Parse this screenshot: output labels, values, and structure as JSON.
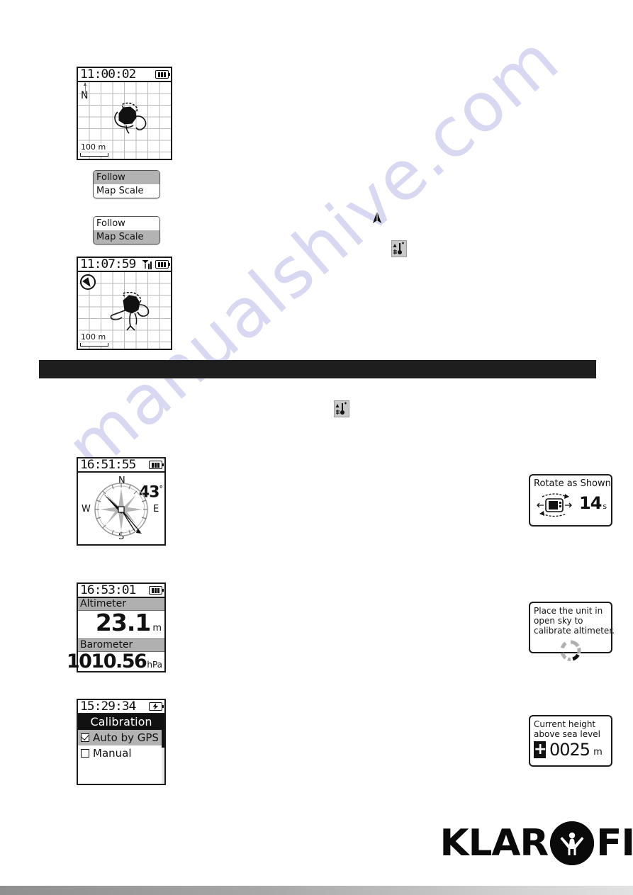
{
  "page": {
    "brand_left": "KLAR",
    "brand_right": "FIT",
    "watermark": "manualshive.com"
  },
  "screens": {
    "map_north_up": {
      "time": "11:00:02",
      "north_label": "N",
      "scale_label": "100 m",
      "battery": "battery-full-icon",
      "track_icon": "gps-track-trace"
    },
    "map_follow": {
      "time": "11:07:59",
      "scale_label": "100 m",
      "battery": "battery-full-icon",
      "signal": "gps-signal-icon",
      "compass_badge": "compass-rose-icon",
      "track_icon": "gps-track-trace"
    },
    "compass": {
      "time": "16:51:55",
      "heading": "43",
      "heading_degree": "°",
      "north": "N",
      "east": "E",
      "south": "S",
      "west": "W",
      "battery": "battery-full-icon"
    },
    "altimeter": {
      "time": "16:53:01",
      "altimeter_label": "Altimeter",
      "altimeter_value": "23.1",
      "altimeter_unit": "m",
      "barometer_label": "Barometer",
      "barometer_value": "1010.56",
      "barometer_unit": "hPa",
      "battery": "battery-full-icon"
    },
    "calibration": {
      "time": "15:29:34",
      "title": "Calibration",
      "options": [
        {
          "label": "Auto by GPS",
          "checked": true,
          "selected": true
        },
        {
          "label": "Manual",
          "checked": false,
          "selected": false
        }
      ],
      "battery": "battery-charging-icon"
    }
  },
  "menus": {
    "map_menu_follow": {
      "items": [
        {
          "label": "Follow",
          "selected": true
        },
        {
          "label": "Map Scale",
          "selected": false
        }
      ]
    },
    "map_menu_scale": {
      "items": [
        {
          "label": "Follow",
          "selected": false
        },
        {
          "label": "Map Scale",
          "selected": true
        }
      ]
    }
  },
  "popups": {
    "rotate": {
      "title": "Rotate as Shown",
      "seconds": "14",
      "seconds_unit": "s"
    },
    "open_sky": {
      "line1": "Place the unit in",
      "line2": "open sky to",
      "line3": "calibrate altimeter."
    },
    "sea_level": {
      "line1": "Current height",
      "line2": "above sea level",
      "sign": "+",
      "value": "0025",
      "unit": "m"
    }
  },
  "inline_icons": {
    "navigation_arrow": "navigation-arrow-icon",
    "sensor_mode_1": "compass-altimeter-mode-icon",
    "sensor_mode_2": "compass-altimeter-mode-icon"
  }
}
